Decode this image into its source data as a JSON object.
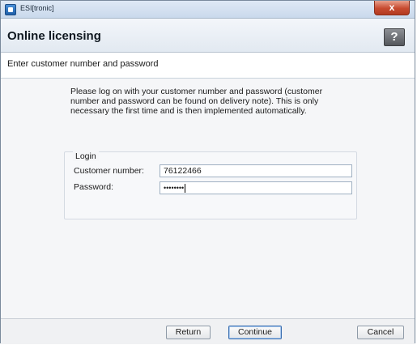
{
  "window": {
    "title": "ESI[tronic]",
    "close_label": "x"
  },
  "header": {
    "title": "Online licensing",
    "help_label": "?"
  },
  "subheader": {
    "text": "Enter customer number and password"
  },
  "intro": {
    "text": "Please log on with your customer number and password (customer number and password can be found on delivery note). This is only necessary the first time and is then implemented automatically."
  },
  "login": {
    "legend": "Login",
    "customer_number_label": "Customer number:",
    "customer_number_value": "76122466",
    "password_label": "Password:",
    "password_value": "••••••••"
  },
  "footer": {
    "return_label": "Return",
    "continue_label": "Continue",
    "cancel_label": "Cancel"
  },
  "colors": {
    "close_button": "#c74a2f",
    "help_button": "#54575c",
    "default_button_border": "#3a6fb0"
  }
}
